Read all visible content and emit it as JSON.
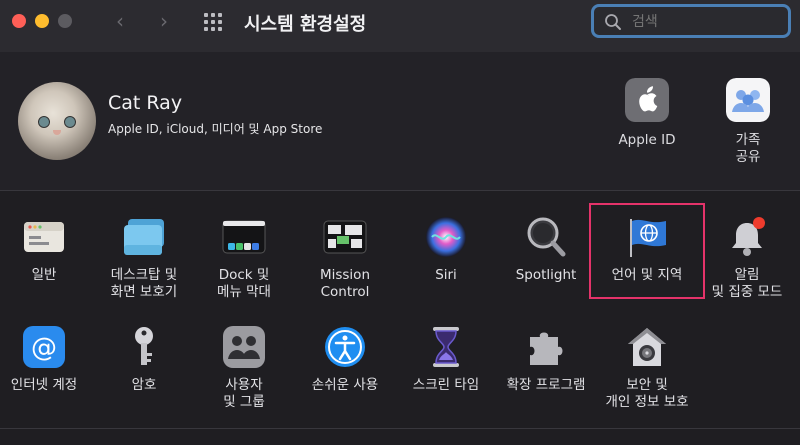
{
  "window": {
    "title": "시스템 환경설정",
    "nav_back": "‹",
    "nav_forward": "›"
  },
  "search": {
    "placeholder": "검색"
  },
  "account": {
    "name": "Cat Ray",
    "subtitle": "Apple ID, iCloud, 미디어 및 App Store",
    "apple_id_label": "Apple ID",
    "family_label_line1": "가족",
    "family_label_line2": "공유"
  },
  "panes_row1": [
    {
      "line1": "일반",
      "line2": "",
      "icon": "general-icon"
    },
    {
      "line1": "데스크탑 및",
      "line2": "화면 보호기",
      "icon": "desktop-screensaver-icon"
    },
    {
      "line1": "Dock 및",
      "line2": "메뉴 막대",
      "icon": "dock-menubar-icon"
    },
    {
      "line1": "Mission",
      "line2": "Control",
      "icon": "mission-control-icon"
    },
    {
      "line1": "Siri",
      "line2": "",
      "icon": "siri-icon"
    },
    {
      "line1": "Spotlight",
      "line2": "",
      "icon": "spotlight-icon"
    },
    {
      "line1": "언어 및 지역",
      "line2": "",
      "icon": "language-region-icon"
    },
    {
      "line1": "알림",
      "line2": "및 집중 모드",
      "icon": "notifications-icon"
    }
  ],
  "panes_row2": [
    {
      "line1": "인터넷 계정",
      "line2": "",
      "icon": "internet-accounts-icon"
    },
    {
      "line1": "암호",
      "line2": "",
      "icon": "passwords-icon"
    },
    {
      "line1": "사용자",
      "line2": "및 그룹",
      "icon": "users-groups-icon"
    },
    {
      "line1": "손쉬운 사용",
      "line2": "",
      "icon": "accessibility-icon"
    },
    {
      "line1": "스크린 타임",
      "line2": "",
      "icon": "screen-time-icon"
    },
    {
      "line1": "확장 프로그램",
      "line2": "",
      "icon": "extensions-icon"
    },
    {
      "line1": "보안 및",
      "line2": "개인 정보 보호",
      "icon": "security-privacy-icon"
    }
  ],
  "colors": {
    "highlight": "#e4336a",
    "search_focus": "#4a7fb5"
  }
}
